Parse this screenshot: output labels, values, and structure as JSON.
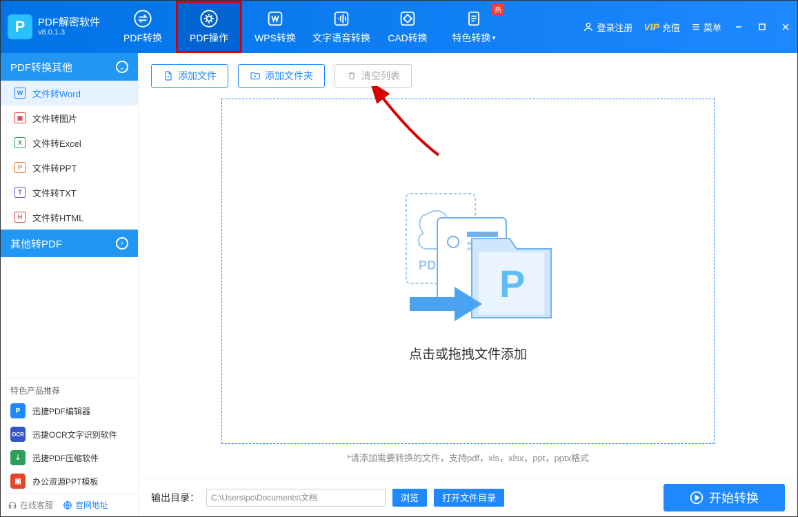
{
  "app": {
    "title": "PDF解密软件",
    "version": "v8.0.1.3"
  },
  "tabs": [
    {
      "label": "PDF转换"
    },
    {
      "label": "PDF操作"
    },
    {
      "label": "WPS转换"
    },
    {
      "label": "文字语音转换"
    },
    {
      "label": "CAD转换"
    },
    {
      "label": "特色转换",
      "hot": "热"
    }
  ],
  "header_right": {
    "login": "登录注册",
    "vip_prefix": "VIP",
    "vip_suffix": "充值",
    "menu": "菜单"
  },
  "sidebar": {
    "section1": {
      "title": "PDF转换其他"
    },
    "items": [
      {
        "label": "文件转Word",
        "glyph": "W"
      },
      {
        "label": "文件转图片",
        "glyph": "▣"
      },
      {
        "label": "文件转Excel",
        "glyph": "X"
      },
      {
        "label": "文件转PPT",
        "glyph": "P"
      },
      {
        "label": "文件转TXT",
        "glyph": "T"
      },
      {
        "label": "文件转HTML",
        "glyph": "H"
      }
    ],
    "section2": {
      "title": "其他转PDF"
    }
  },
  "promo": {
    "title": "特色产品推荐",
    "items": [
      {
        "label": "迅捷PDF编辑器"
      },
      {
        "label": "迅捷OCR文字识别软件"
      },
      {
        "label": "迅捷PDF压缩软件"
      },
      {
        "label": "办公资源PPT模板"
      }
    ]
  },
  "sidebar_footer": {
    "service": "在线客服",
    "site": "官网地址"
  },
  "toolbar": {
    "add_file": "添加文件",
    "add_folder": "添加文件夹",
    "clear": "清空列表"
  },
  "dropzone": {
    "title": "点击或拖拽文件添加",
    "hint": "*请添加需要转换的文件，支持pdf，xls，xlsx，ppt，pptx格式"
  },
  "footer": {
    "output_label": "输出目录：",
    "output_path": "C:\\Users\\pc\\Documents\\文档",
    "browse": "浏览",
    "open_dir": "打开文件目录",
    "start": "开始转换"
  }
}
